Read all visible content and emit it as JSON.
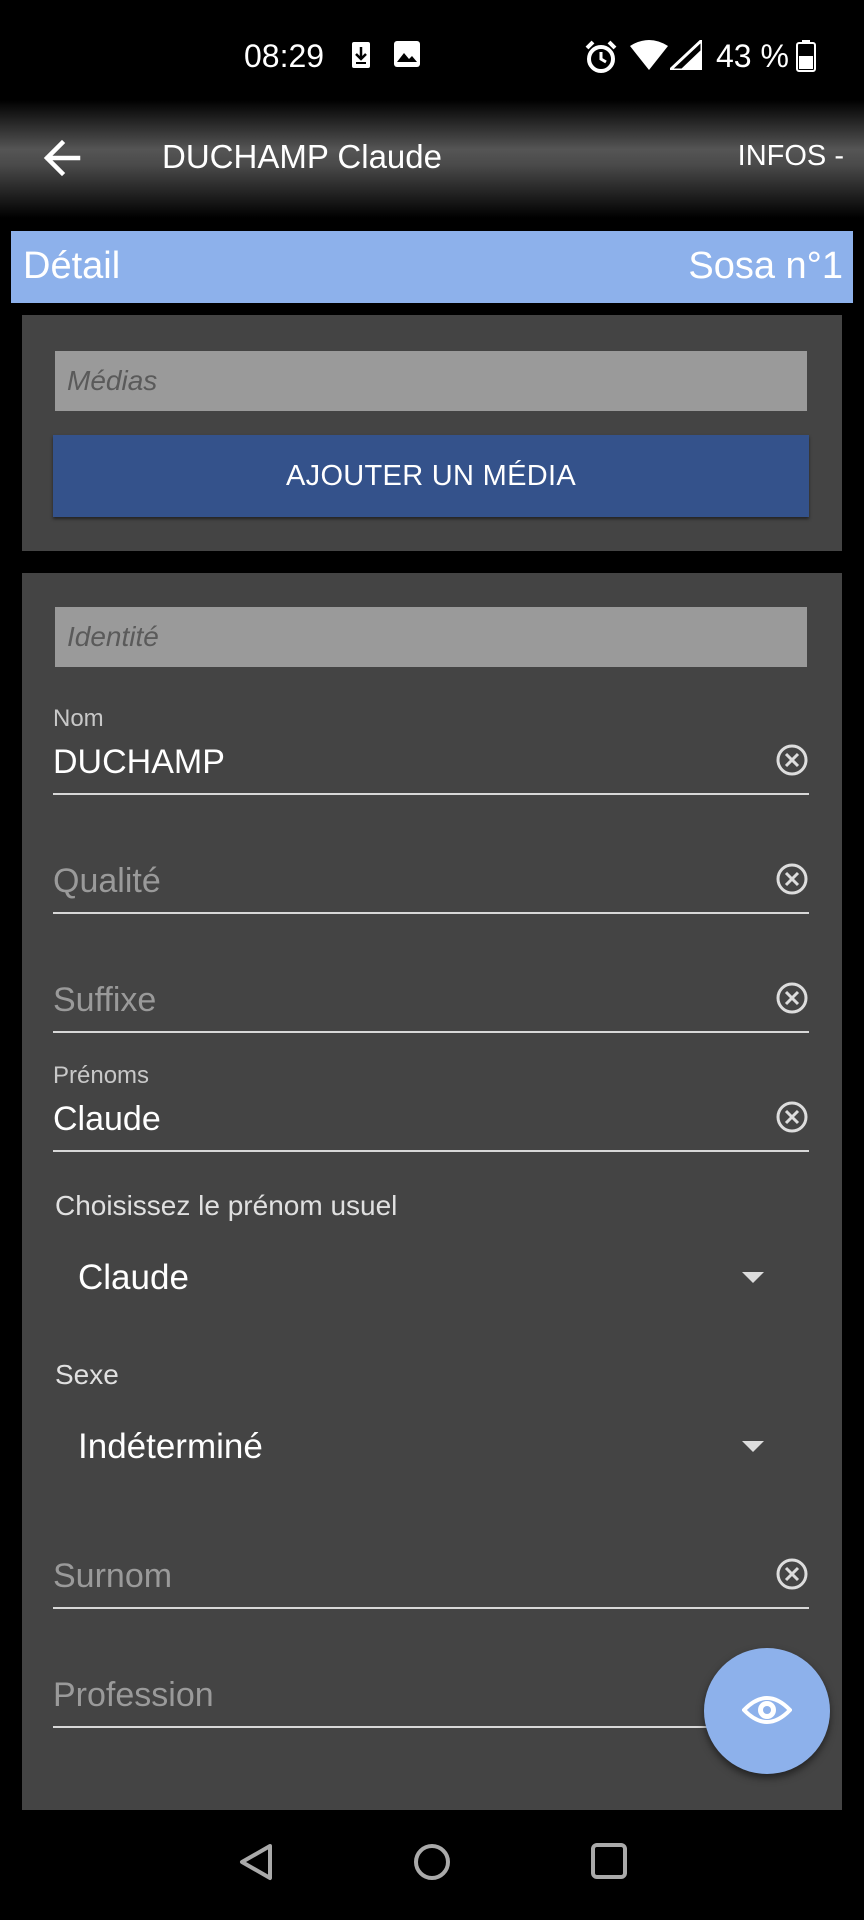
{
  "status_bar": {
    "time": "08:29",
    "battery": "43 %",
    "icons": [
      "download-icon",
      "image-icon",
      "alarm-icon",
      "wifi-icon",
      "signal-icon",
      "battery-icon"
    ]
  },
  "app_bar": {
    "title": "DUCHAMP Claude",
    "action": "INFOS -",
    "back_icon": "arrow-left-icon"
  },
  "detail_band": {
    "title": "Détail",
    "sosa": "Sosa n°1",
    "color": "#8db1eb"
  },
  "media_section": {
    "header": "Médias",
    "add_button": "AJOUTER UN MÉDIA",
    "button_color": "#34528b"
  },
  "identity_section": {
    "header": "Identité",
    "fields": {
      "nom": {
        "label": "Nom",
        "value": "DUCHAMP"
      },
      "qualite": {
        "placeholder": "Qualité"
      },
      "suffixe": {
        "placeholder": "Suffixe"
      },
      "prenoms": {
        "label": "Prénoms",
        "value": "Claude"
      },
      "surnom": {
        "placeholder": "Surnom"
      },
      "profession": {
        "placeholder": "Profession"
      }
    },
    "selects": {
      "prenom_usuel": {
        "label": "Choisissez le prénom usuel",
        "value": "Claude"
      },
      "sexe": {
        "label": "Sexe",
        "value": "Indéterminé"
      }
    }
  },
  "fab": {
    "icon": "eye-icon",
    "color": "#8db1eb"
  },
  "nav_bar": {
    "icons": [
      "back-triangle-icon",
      "home-circle-icon",
      "recents-square-icon"
    ]
  }
}
